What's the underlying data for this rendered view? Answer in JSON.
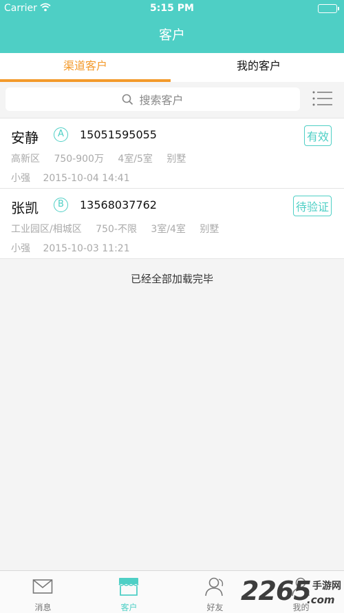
{
  "status_bar": {
    "carrier": "Carrier",
    "time": "5:15 PM"
  },
  "nav": {
    "title": "客户"
  },
  "tabs": [
    {
      "label": "渠道客户",
      "active": true
    },
    {
      "label": "我的客户",
      "active": false
    }
  ],
  "search": {
    "placeholder": "搜索客户"
  },
  "customers": [
    {
      "name": "安静",
      "level": "A",
      "phone": "15051595055",
      "status": "有效",
      "district": "高新区",
      "budget": "750-900万",
      "layout": "4室/5室",
      "type": "别墅",
      "agent": "小强",
      "datetime": "2015-10-04 14:41"
    },
    {
      "name": "张凯",
      "level": "B",
      "phone": "13568037762",
      "status": "待验证",
      "district": "工业园区/相城区",
      "budget": "750-不限",
      "layout": "3室/4室",
      "type": "别墅",
      "agent": "小强",
      "datetime": "2015-10-03 11:21"
    }
  ],
  "list_footer": "已经全部加载完毕",
  "tabbar": [
    {
      "label": "消息",
      "icon": "mail-icon",
      "active": false
    },
    {
      "label": "客户",
      "icon": "store-icon",
      "active": true
    },
    {
      "label": "好友",
      "icon": "friends-icon",
      "active": false
    },
    {
      "label": "我的",
      "icon": "profile-icon",
      "active": false
    }
  ],
  "watermark": {
    "number": "2265",
    "site_cn": "手游网",
    "suffix": ".com"
  },
  "colors": {
    "accent": "#4ecfc5",
    "tab_active": "#f39a2b",
    "background": "#f4f4f4"
  }
}
